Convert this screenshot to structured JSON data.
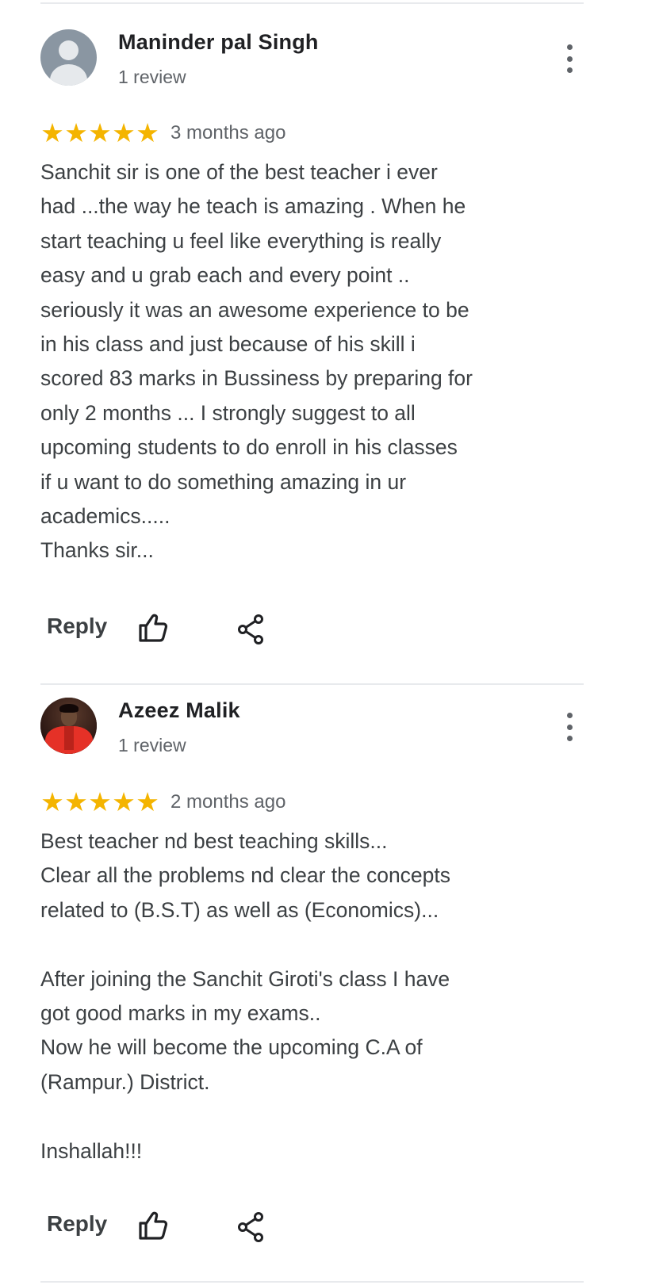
{
  "reviews": [
    {
      "author": "Maninder pal Singh",
      "review_count": "1 review",
      "avatar": "default-person-icon",
      "stars": [
        "★",
        "★",
        "★",
        "★",
        "★"
      ],
      "rating": 5,
      "time_ago": "3 months ago",
      "text": "Sanchit sir is one of the best teacher i ever\nhad ...the way he teach is amazing . When he\nstart teaching u feel like everything is really\neasy and u grab each and every point ..\nseriously it was an awesome experience to be\nin his class and just because of his skill i\nscored 83 marks in Bussiness by preparing for\nonly 2 months ... I strongly suggest to all\nupcoming students to do enroll in his classes\nif u want to do something amazing in ur\nacademics.....\nThanks sir...",
      "reply_label": "Reply"
    },
    {
      "author": "Azeez Malik",
      "review_count": "1 review",
      "avatar": "profile-photo",
      "stars": [
        "★",
        "★",
        "★",
        "★",
        "★"
      ],
      "rating": 5,
      "time_ago": "2 months ago",
      "text": "Best teacher nd best teaching skills...\nClear all the problems nd clear the concepts\nrelated to (B.S.T) as well as (Economics)...\n\nAfter joining the Sanchit Giroti's class I have\ngot good marks in my exams..\nNow he will become the upcoming C.A of\n(Rampur.) District.\n\nInshallah!!!",
      "reply_label": "Reply"
    }
  ],
  "colors": {
    "star": "#f4b400",
    "text": "#3c4043",
    "secondary": "#5f6368",
    "divider": "#e8eaed"
  }
}
